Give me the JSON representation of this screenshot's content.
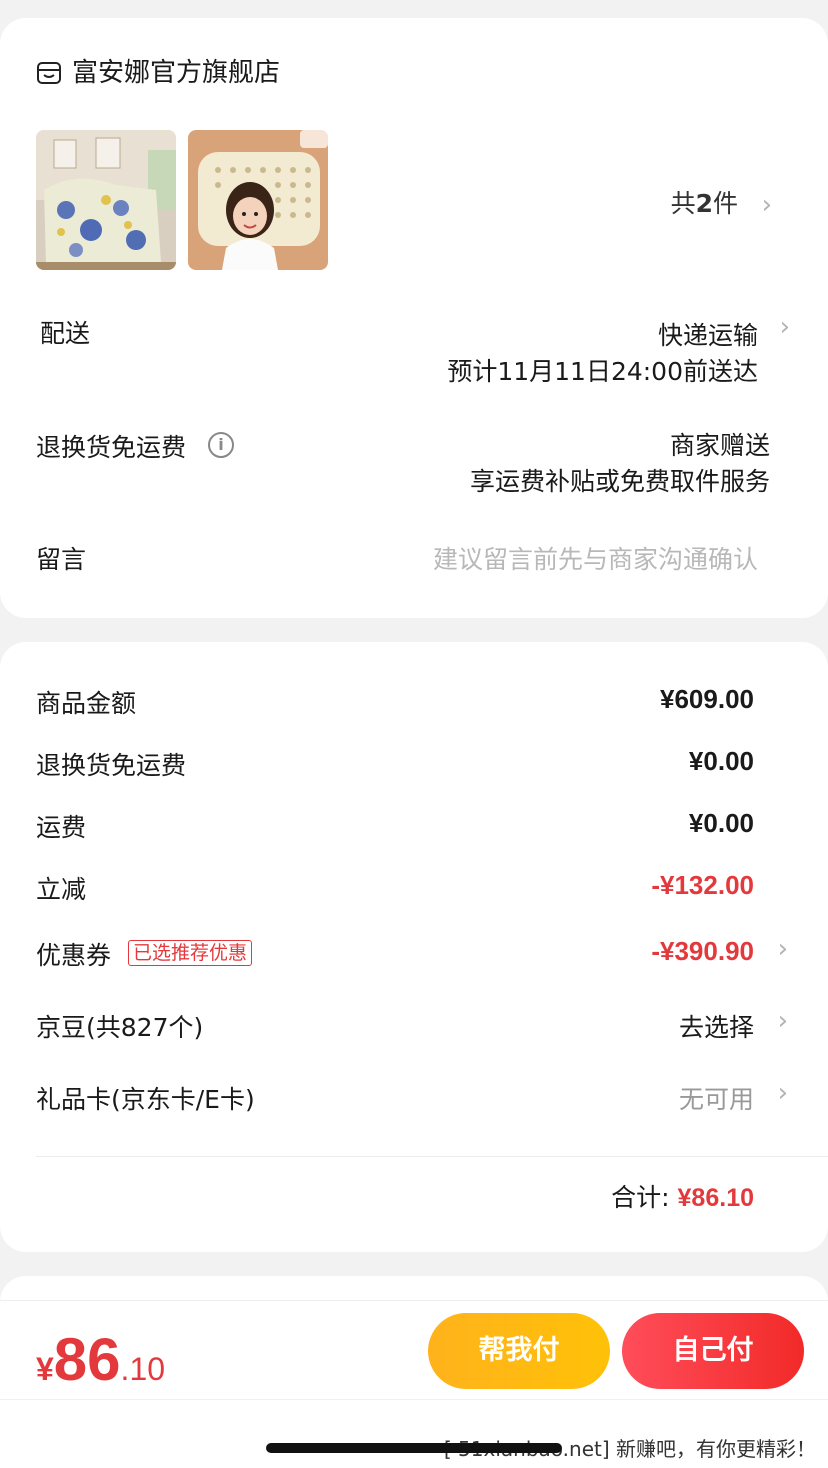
{
  "store": {
    "name": "富安娜官方旗舰店",
    "icon": "store-icon"
  },
  "products": {
    "count_prefix": "共",
    "count": "2",
    "count_suffix": "件"
  },
  "delivery": {
    "label": "配送",
    "method": "快递运输",
    "eta": "预计11月11日24:00前送达"
  },
  "return_shipping": {
    "label": "退换货免运费",
    "value": "商家赠送",
    "desc": "享运费补贴或免费取件服务"
  },
  "message": {
    "label": "留言",
    "placeholder": "建议留言前先与商家沟通确认"
  },
  "summary": {
    "goods_label": "商品金额",
    "goods_value": "¥609.00",
    "return_label": "退换货免运费",
    "return_value": "¥0.00",
    "shipping_label": "运费",
    "shipping_value": "¥0.00",
    "discount_label": "立减",
    "discount_value": "-¥132.00",
    "coupon_label": "优惠券",
    "coupon_tag": "已选推荐优惠",
    "coupon_value": "-¥390.90",
    "jingdou_label": "京豆(共827个)",
    "jingdou_value": "去选择",
    "giftcard_label": "礼品卡(京东卡/E卡)",
    "giftcard_value": "无可用",
    "total_label": "合计:",
    "total_value": "¥86.10"
  },
  "bottom": {
    "currency": "¥",
    "amount_int": "86",
    "amount_dec": ".10",
    "help_pay": "帮我付",
    "self_pay": "自己付",
    "watermark": "[ 51xianbao.net] 新赚吧，有你更精彩！"
  },
  "colors": {
    "accent_red": "#e4393c",
    "help_button": "#ffb21c",
    "self_button": "#f22a28"
  }
}
